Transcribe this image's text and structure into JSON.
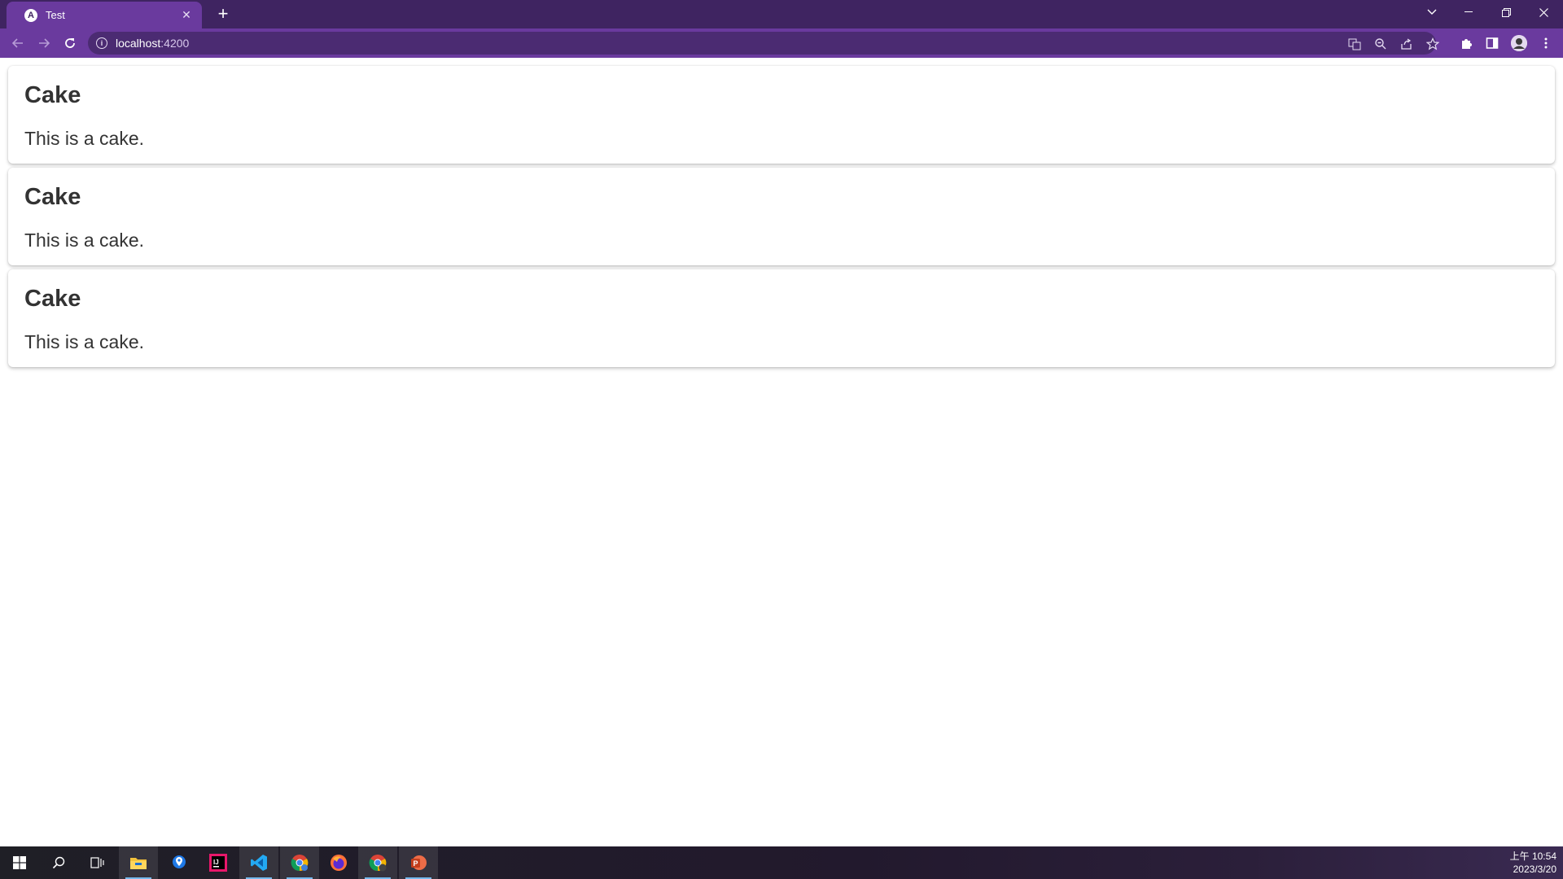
{
  "browser": {
    "tab_title": "Test",
    "tab_favicon_letter": "A",
    "close_tab_label": "✕",
    "new_tab_label": "+",
    "address_host": "localhost",
    "address_port": ":4200",
    "theme_color": "#6a3a9e",
    "icons": [
      "back-icon",
      "forward-icon",
      "reload-icon",
      "info-icon",
      "translate-icon",
      "zoom-icon",
      "share-icon",
      "star-icon",
      "extensions-icon",
      "side-panel-icon",
      "profile-avatar",
      "menu-icon"
    ]
  },
  "cards": [
    {
      "title": "Cake",
      "text": "This is a cake."
    },
    {
      "title": "Cake",
      "text": "This is a cake."
    },
    {
      "title": "Cake",
      "text": "This is a cake."
    }
  ],
  "taskbar": {
    "apps": [
      "start-icon",
      "search-icon",
      "task-view-icon",
      "file-explorer-icon",
      "maps-icon",
      "jetbrains-icon",
      "vscode-icon",
      "chrome-icon",
      "firefox-icon",
      "chrome-profile-icon",
      "powerpoint-icon"
    ],
    "time": "上午 10:54",
    "date": "2023/3/20"
  }
}
